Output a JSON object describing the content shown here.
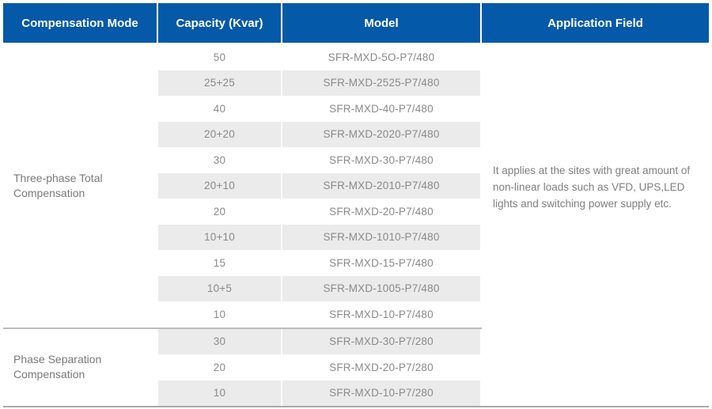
{
  "table": {
    "headers": [
      "Compensation Mode",
      "Capacity (Kvar)",
      "Model",
      "Application Field"
    ],
    "header_color": "#0459a9",
    "sections": [
      {
        "mode": "Three-phase Total Compensation",
        "rows": [
          {
            "capacity": "50",
            "model": "SFR-MXD-5O-P7/480",
            "shaded": false
          },
          {
            "capacity": "25+25",
            "model": "SFR-MXD-2525-P7/480",
            "shaded": true
          },
          {
            "capacity": "40",
            "model": "SFR-MXD-40-P7/480",
            "shaded": false
          },
          {
            "capacity": "20+20",
            "model": "SFR-MXD-2020-P7/480",
            "shaded": true
          },
          {
            "capacity": "30",
            "model": "SFR-MXD-30-P7/480",
            "shaded": false
          },
          {
            "capacity": "20+10",
            "model": "SFR-MXD-2010-P7/480",
            "shaded": true
          },
          {
            "capacity": "20",
            "model": "SFR-MXD-20-P7/480",
            "shaded": false
          },
          {
            "capacity": "10+10",
            "model": "SFR-MXD-1010-P7/480",
            "shaded": true
          },
          {
            "capacity": "15",
            "model": "SFR-MXD-15-P7/480",
            "shaded": false
          },
          {
            "capacity": "10+5",
            "model": "SFR-MXD-1005-P7/480",
            "shaded": true
          },
          {
            "capacity": "10",
            "model": "SFR-MXD-10-P7/480",
            "shaded": false
          }
        ]
      },
      {
        "mode": "Phase Separation Compensation",
        "rows": [
          {
            "capacity": "30",
            "model": "SFR-MXD-30-P7/280",
            "shaded": true
          },
          {
            "capacity": "20",
            "model": "SFR-MXD-20-P7/280",
            "shaded": false
          },
          {
            "capacity": "10",
            "model": "SFR-MXD-10-P7/280",
            "shaded": true
          }
        ]
      }
    ],
    "application_field": "It applies at the sites with great amount of non-linear loads such as VFD, UPS,LED lights and switching power supply etc."
  }
}
